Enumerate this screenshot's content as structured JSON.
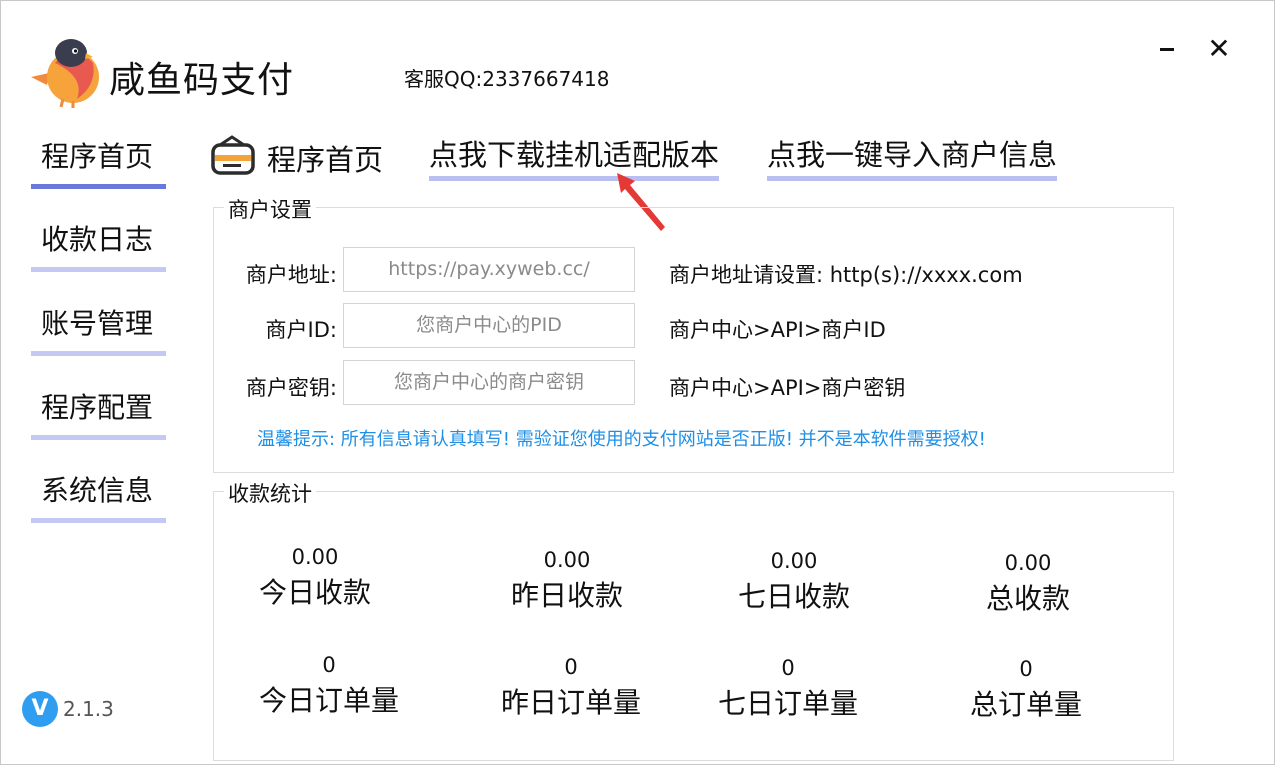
{
  "app": {
    "title": "咸鱼码支付",
    "contact": "客服QQ:2337667418",
    "version": "2.1.3",
    "version_badge": "V"
  },
  "window": {
    "minimize_icon": "minimize-icon",
    "close_label": "✕"
  },
  "sidebar": {
    "items": [
      {
        "label": "程序首页",
        "active": true
      },
      {
        "label": "收款日志",
        "active": false
      },
      {
        "label": "账号管理",
        "active": false
      },
      {
        "label": "程序配置",
        "active": false
      },
      {
        "label": "系统信息",
        "active": false
      }
    ]
  },
  "header": {
    "page_title": "程序首页",
    "download_link": "点我下载挂机适配版本",
    "import_link": "点我一键导入商户信息"
  },
  "merchant": {
    "group_title": "商户设置",
    "fields": [
      {
        "label": "商户地址:",
        "value": "https://pay.xyweb.cc/",
        "hint": "商户地址请设置: http(s)://xxxx.com"
      },
      {
        "label": "商户ID:",
        "value": "您商户中心的PID",
        "hint": "商户中心>API>商户ID"
      },
      {
        "label": "商户密钥:",
        "value": "您商户中心的商户密钥",
        "hint": "商户中心>API>商户密钥"
      }
    ],
    "tip": "温馨提示: 所有信息请认真填写! 需验证您使用的支付网站是否正版! 并不是本软件需要授权!"
  },
  "stats": {
    "group_title": "收款统计",
    "amounts": [
      {
        "value": "0.00",
        "label": "今日收款"
      },
      {
        "value": "0.00",
        "label": "昨日收款"
      },
      {
        "value": "0.00",
        "label": "七日收款"
      },
      {
        "value": "0.00",
        "label": "总收款"
      }
    ],
    "orders": [
      {
        "value": "0",
        "label": "今日订单量"
      },
      {
        "value": "0",
        "label": "昨日订单量"
      },
      {
        "value": "0",
        "label": "七日订单量"
      },
      {
        "value": "0",
        "label": "总订单量"
      }
    ]
  },
  "colors": {
    "nav_active_bar": "#6a78dc",
    "nav_bar": "#c4c9f4",
    "tip_text": "#1f8fe6",
    "version_badge": "#2f9ef0",
    "arrow": "#e53935"
  }
}
